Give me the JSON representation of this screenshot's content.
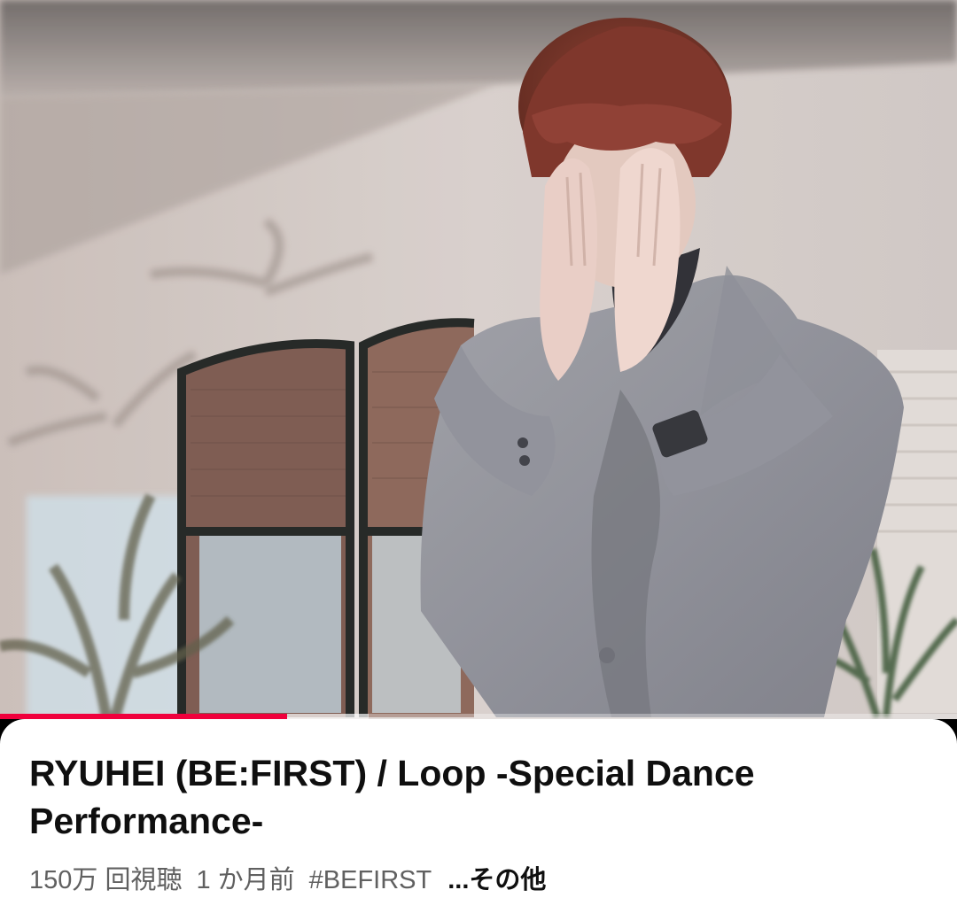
{
  "video": {
    "progress_fraction": 0.3,
    "buffer_fraction": 0.385,
    "accent_color": "#f0003c"
  },
  "info": {
    "title": "RYUHEI (BE:FIRST) / Loop -Special Dance Performance-",
    "views": "150万 回視聴",
    "age": "1 か月前",
    "hashtag": "#BEFIRST",
    "more_label": "...その他"
  }
}
